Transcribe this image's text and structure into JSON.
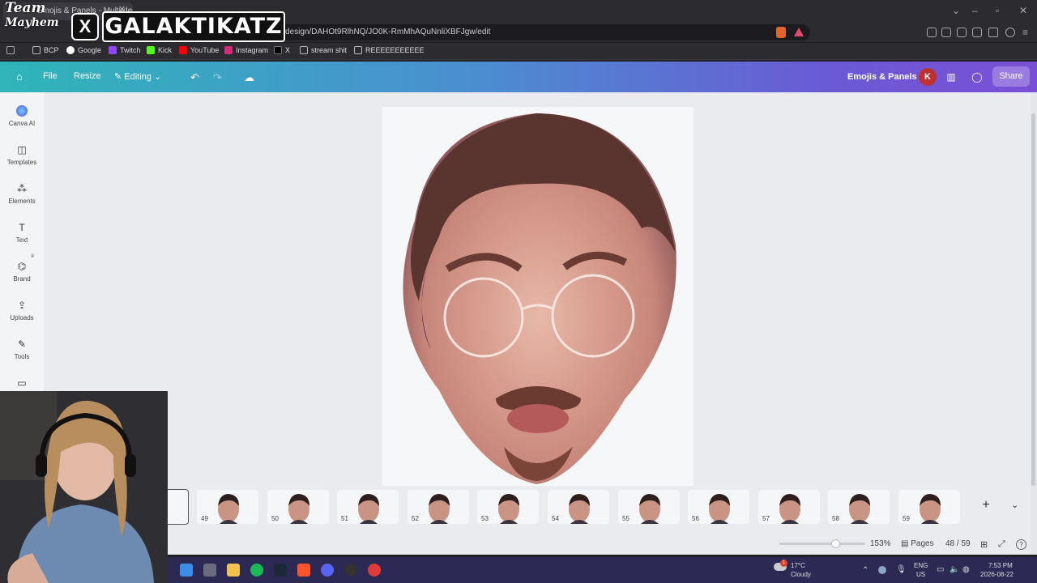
{
  "browser": {
    "tab_title": "Emojis & Panels - Multi-design",
    "url": "design/DAHOt9RlhNQ/JO0K-RmMhAQuNnliXBFJgw/edit",
    "bookmarks": [
      "BCP",
      "Google",
      "Twitch",
      "Kick",
      "YouTube",
      "Instagram",
      "X",
      "stream shit",
      "REEEEEEEEEEE"
    ]
  },
  "toolbar": {
    "file": "File",
    "resize": "Resize",
    "editing": "Editing",
    "design_title": "Emojis & Panels",
    "avatar": "K",
    "share": "Share"
  },
  "sidebar": {
    "items": [
      "Canva AI",
      "Templates",
      "Elements",
      "Text",
      "Brand",
      "Uploads",
      "Tools"
    ]
  },
  "pages": {
    "numbers": [
      "49",
      "50",
      "51",
      "52",
      "53",
      "54",
      "55",
      "56",
      "57",
      "58",
      "59"
    ],
    "zoom": "153%",
    "pages_label": "Pages",
    "counter": "48 / 59"
  },
  "taskbar": {
    "temp": "17°C",
    "weather": "Cloudy",
    "lang": "ENG",
    "region": "US",
    "time": "7:53 PM",
    "date": "2026-08-22",
    "notif": "1"
  },
  "overlay": {
    "team": "Team",
    "team2": "Mayhem",
    "x_logo": "X",
    "name": "GALAKTIKATZ"
  },
  "colors": {
    "accent_start": "#2fb5b9",
    "accent_end": "#7a4fd6",
    "avatar": "#c0302f",
    "taskbar": "#2c2a55"
  }
}
